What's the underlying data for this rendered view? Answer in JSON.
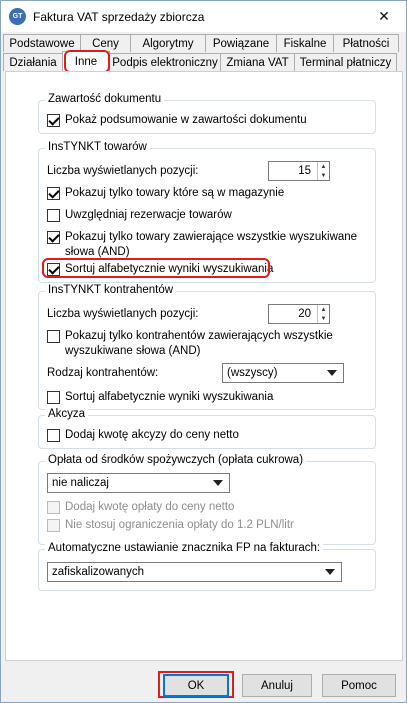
{
  "window": {
    "title": "Faktura VAT sprzedaży zbiorcza",
    "icon_text": "GT",
    "close_symbol": "✕"
  },
  "tabs": {
    "row1": [
      "Podstawowe",
      "Ceny",
      "Algorytmy",
      "Powiązane",
      "Fiskalne",
      "Płatności"
    ],
    "row2": [
      "Działania",
      "Inne",
      "Podpis elektroniczny",
      "Zmiana VAT",
      "Terminal płatniczy"
    ],
    "active": "Inne"
  },
  "zawartosc": {
    "legend": "Zawartość dokumentu",
    "show_summary_label": "Pokaż podsumowanie w zawartości dokumentu",
    "show_summary_checked": true
  },
  "instynkt_towarow": {
    "legend": "InsTYNKT towarów",
    "count_label": "Liczba wyświetlanych pozycji:",
    "count_value": "15",
    "only_in_stock_label": "Pokazuj tylko towary które są w magazynie",
    "only_in_stock_checked": true,
    "reservations_label": "Uwzględniaj rezerwacje towarów",
    "reservations_checked": false,
    "all_words_label_1": "Pokazuj tylko towary zawierające wszystkie wyszukiwane",
    "all_words_label_2": "słowa (AND)",
    "all_words_checked": true,
    "sort_label": "Sortuj alfabetycznie wyniki wyszukiwania",
    "sort_checked": true
  },
  "instynkt_kontrahentow": {
    "legend": "InsTYNKT kontrahentów",
    "count_label": "Liczba wyświetlanych pozycji:",
    "count_value": "20",
    "all_words_label_1": "Pokazuj tylko kontrahentów zawierających wszystkie",
    "all_words_label_2": "wyszukiwane słowa (AND)",
    "all_words_checked": false,
    "type_label": "Rodzaj kontrahentów:",
    "type_value": "(wszyscy)",
    "sort_label": "Sortuj alfabetycznie wyniki wyszukiwania",
    "sort_checked": false
  },
  "akcyza": {
    "legend": "Akcyza",
    "add_label": "Dodaj kwotę akcyzy do ceny netto",
    "add_checked": false
  },
  "oplata": {
    "legend": "Opłata od środków spożywczych (opłata cukrowa)",
    "select_value": "nie naliczaj",
    "add_label": "Dodaj kwotę opłaty do ceny netto",
    "add_checked": false,
    "no_limit_label": "Nie stosuj ograniczenia opłaty do 1.2 PLN/litr",
    "no_limit_checked": false
  },
  "fp": {
    "legend": "Automatyczne ustawianie znacznika FP na fakturach:",
    "select_value": "zafiskalizowanych"
  },
  "buttons": {
    "ok": "OK",
    "cancel": "Anuluj",
    "help": "Pomoc"
  }
}
